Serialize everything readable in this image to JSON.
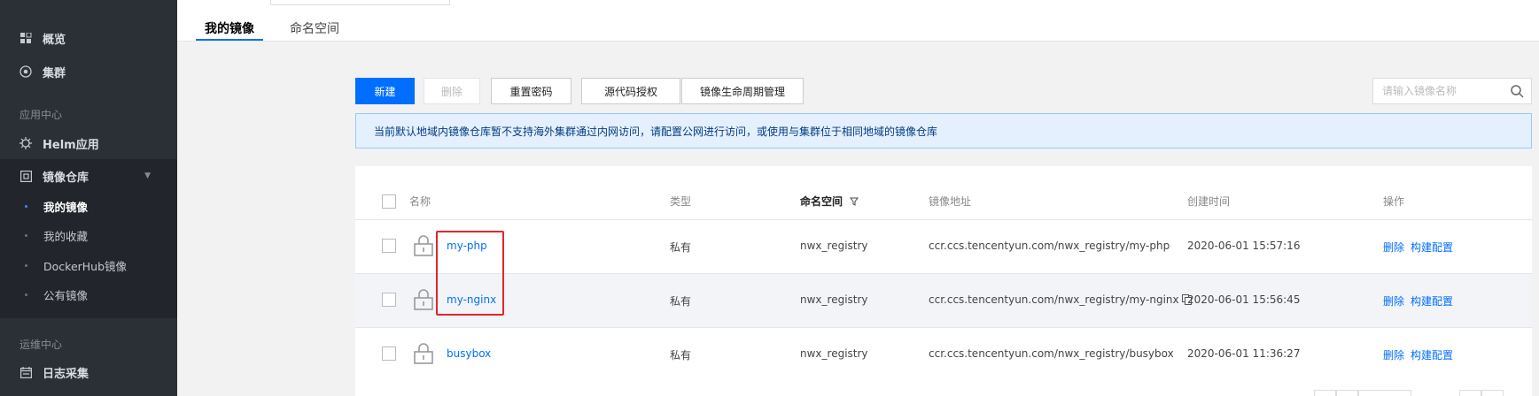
{
  "sidebar": {
    "overview_label": "概览",
    "cluster_label": "集群",
    "group_app_center": "应用中心",
    "helm_label": "Helm应用",
    "registry_label": "镜像仓库",
    "sub_items": [
      "我的镜像",
      "我的收藏",
      "DockerHub镜像",
      "公有镜像"
    ],
    "group_ops_center": "运维中心",
    "log_label": "日志采集"
  },
  "tabs": [
    "我的镜像",
    "命名空间"
  ],
  "toolbar": {
    "new_label": "新建",
    "delete_label": "删除",
    "reset_password_label": "重置密码",
    "source_auth_label": "源代码授权",
    "lifecycle_label": "镜像生命周期管理"
  },
  "search": {
    "placeholder": "请输入镜像名称"
  },
  "notice": "当前默认地域内镜像仓库暂不支持海外集群通过内网访问，请配置公网进行访问，或使用与集群位于相同地域的镜像仓库",
  "table": {
    "headers": {
      "name": "名称",
      "type": "类型",
      "namespace": "命名空间",
      "address": "镜像地址",
      "created": "创建时间",
      "actions": "操作"
    },
    "rows": [
      {
        "name": "my-php",
        "type": "私有",
        "namespace": "nwx_registry",
        "address": "ccr.ccs.tencentyun.com/nwx_registry/my-php",
        "created": "2020-06-01 15:57:16",
        "action_delete": "删除",
        "action_build": "构建配置"
      },
      {
        "name": "my-nginx",
        "type": "私有",
        "namespace": "nwx_registry",
        "address": "ccr.ccs.tencentyun.com/nwx_registry/my-nginx",
        "created": "2020-06-01 15:56:45",
        "action_delete": "删除",
        "action_build": "构建配置"
      },
      {
        "name": "busybox",
        "type": "私有",
        "namespace": "nwx_registry",
        "address": "ccr.ccs.tencentyun.com/nwx_registry/busybox",
        "created": "2020-06-01 11:36:27",
        "action_delete": "删除",
        "action_build": "构建配置"
      }
    ]
  },
  "colors": {
    "primary": "#006eff",
    "sidebar_bg": "#2b2f36",
    "highlight": "#e4252d"
  }
}
